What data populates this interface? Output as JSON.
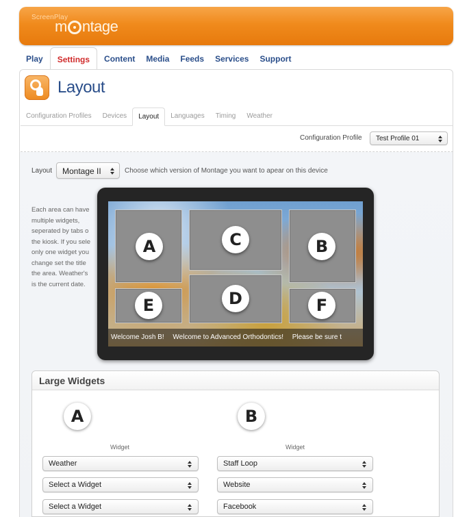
{
  "brand": {
    "small": "ScreenPlay",
    "main_prefix": "m",
    "main_suffix": "ntage"
  },
  "mainnav": [
    "Play",
    "Settings",
    "Content",
    "Media",
    "Feeds",
    "Services",
    "Support"
  ],
  "page": {
    "title": "Layout"
  },
  "subtabs": [
    "Configuration Profiles",
    "Devices",
    "Layout",
    "Languages",
    "Timing",
    "Weather"
  ],
  "config": {
    "label": "Configuration Profile",
    "value": "Test Profile 01"
  },
  "layout": {
    "label": "Layout",
    "value": "Montage II",
    "help": "Choose which version of Montage you want to apear on this device"
  },
  "description": [
    "Each area can have",
    "multiple widgets,",
    "seperated by tabs o",
    "the kiosk. If you sele",
    "only one widget you",
    "change set the title",
    "the area. Weather's",
    "is the current date."
  ],
  "zones": [
    "A",
    "B",
    "C",
    "D",
    "E",
    "F"
  ],
  "ticker": [
    "Welcome Josh B!",
    "Welcome to Advanced Orthodontics!",
    "Please be sure t"
  ],
  "widgets": {
    "title": "Large Widgets",
    "columns": [
      {
        "letter": "A",
        "label": "Widget",
        "selects": [
          "Weather",
          "Select a Widget",
          "Select a Widget"
        ]
      },
      {
        "letter": "B",
        "label": "Widget",
        "selects": [
          "Staff Loop",
          "Website",
          "Facebook"
        ]
      }
    ]
  }
}
